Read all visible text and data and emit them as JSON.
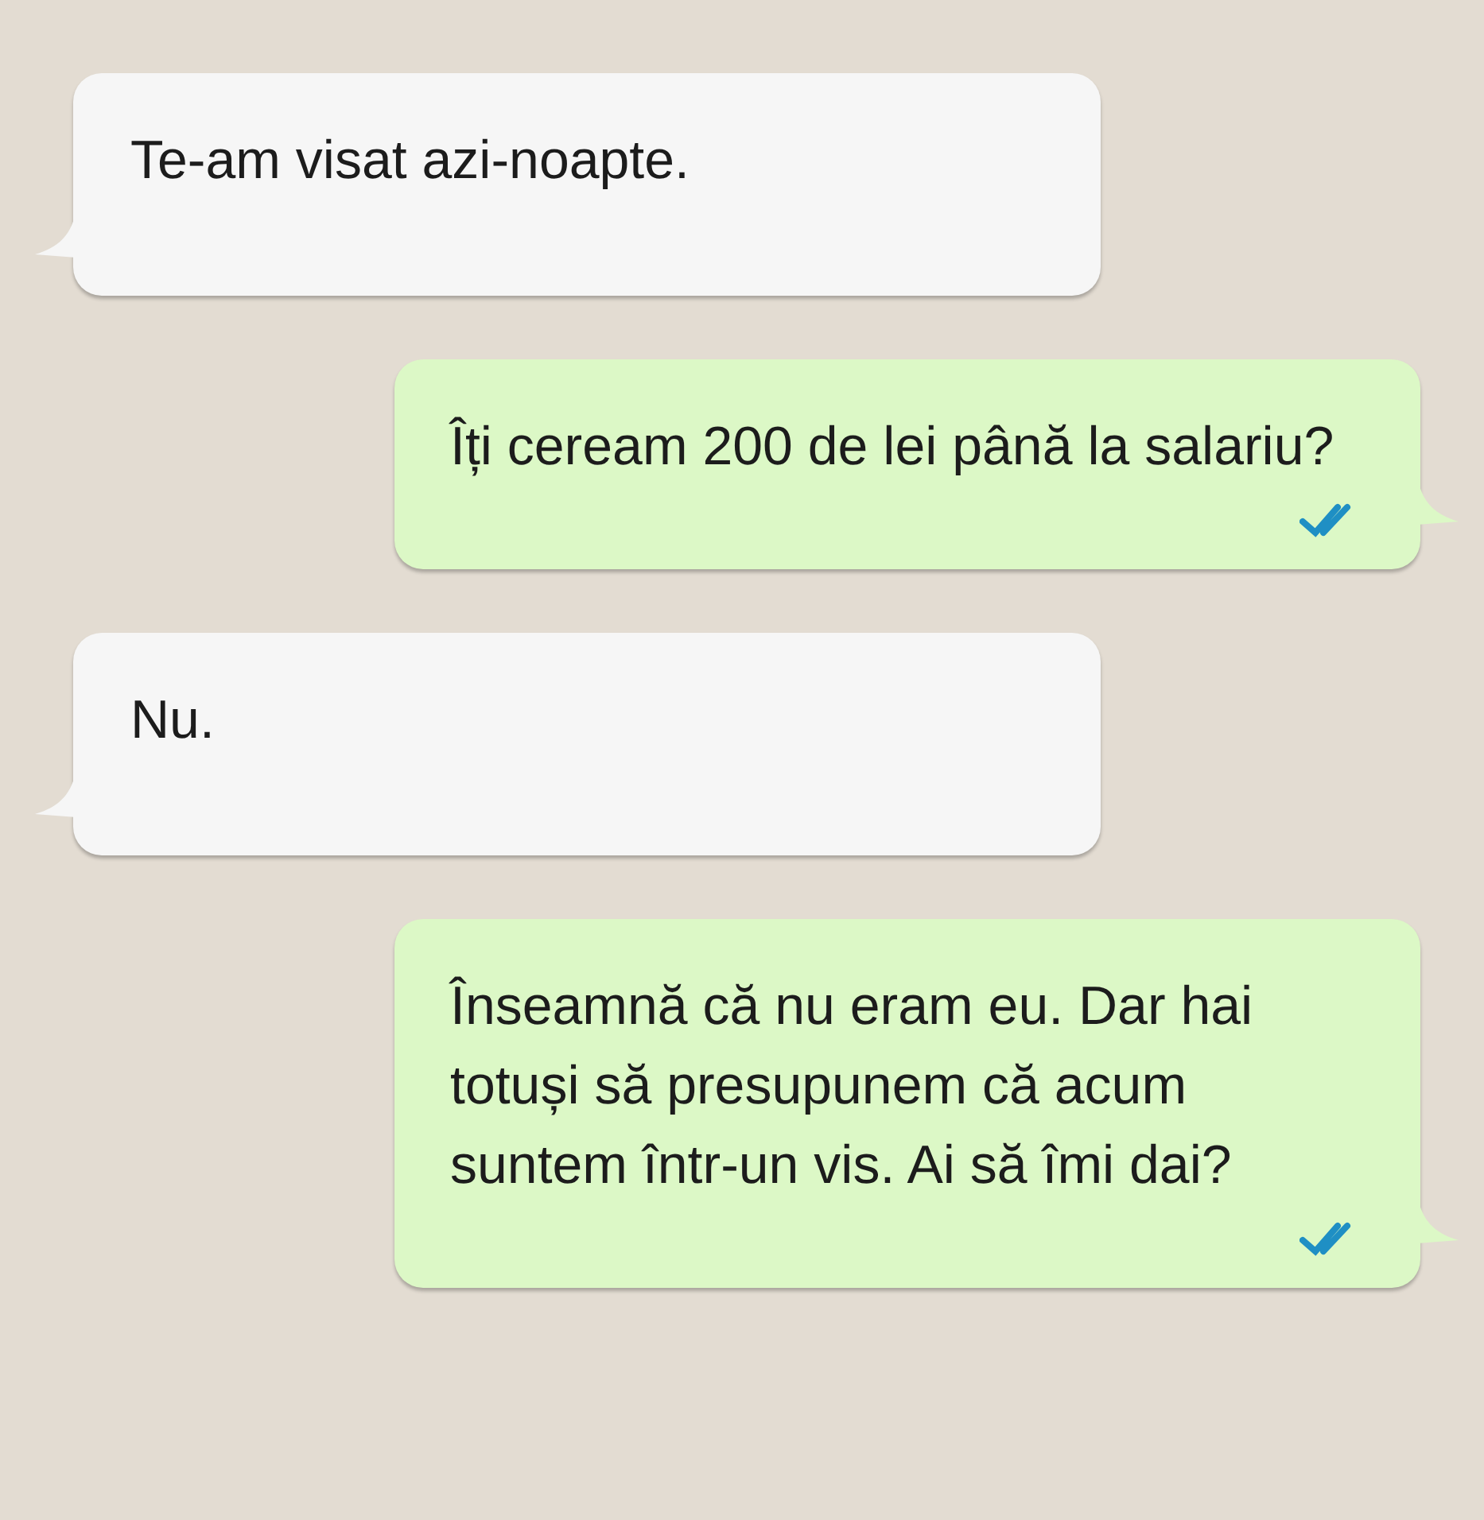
{
  "messages": [
    {
      "kind": "incoming",
      "text": "Te-am visat azi-noapte."
    },
    {
      "kind": "outgoing",
      "text": "Îți ceream 200 de lei până la salariu?",
      "read": true
    },
    {
      "kind": "incoming",
      "text": "Nu."
    },
    {
      "kind": "outgoing",
      "text": "Înseamnă că nu eram eu. Dar hai totuși să presupunem că acum suntem într-un vis. Ai să îmi dai?",
      "read": true
    }
  ]
}
